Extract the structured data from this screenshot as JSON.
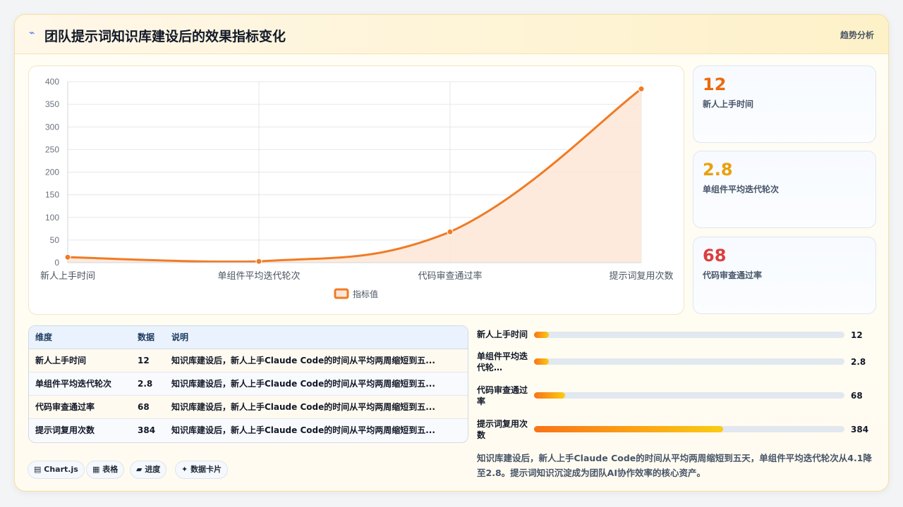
{
  "header": {
    "title": "团队提示词知识库建设后的效果指标变化",
    "tag": "趋势分析",
    "flag_icon": "⌁"
  },
  "chart_data": {
    "type": "area",
    "categories": [
      "新人上手时间",
      "单组件平均迭代轮次",
      "代码审查通过率",
      "提示词复用次数"
    ],
    "series": [
      {
        "name": "指标值",
        "values": [
          12,
          2.8,
          68,
          384
        ]
      }
    ],
    "ylim": [
      0,
      400
    ],
    "yticks": [
      0,
      50,
      100,
      150,
      200,
      250,
      300,
      350,
      400
    ],
    "grid": true,
    "legend": "bottom-center",
    "color": "#f07b25",
    "fill_color": "#fde6d6"
  },
  "kpis": [
    {
      "value": "12",
      "label": "新人上手时间",
      "color": "#ea6a0c"
    },
    {
      "value": "2.8",
      "label": "单组件平均迭代轮次",
      "color": "#e9a10c"
    },
    {
      "value": "68",
      "label": "代码审查通过率",
      "color": "#dc3e3e"
    }
  ],
  "table": {
    "headers": [
      "维度",
      "数据",
      "说明"
    ],
    "rows": [
      [
        "新人上手时间",
        "12",
        "知识库建设后，新人上手Claude Code的时间从平均两周缩短到五..."
      ],
      [
        "单组件平均迭代轮次",
        "2.8",
        "知识库建设后，新人上手Claude Code的时间从平均两周缩短到五..."
      ],
      [
        "代码审查通过率",
        "68",
        "知识库建设后，新人上手Claude Code的时间从平均两周缩短到五..."
      ],
      [
        "提示词复用次数",
        "384",
        "知识库建设后，新人上手Claude Code的时间从平均两周缩短到五..."
      ]
    ]
  },
  "progress": [
    {
      "label": "新人上手时间",
      "value": "12",
      "fraction": 0.047
    },
    {
      "label": "单组件平均迭代轮…",
      "value": "2.8",
      "fraction": 0.047
    },
    {
      "label": "代码审查通过率",
      "value": "68",
      "fraction": 0.1
    },
    {
      "label": "提示词复用次数",
      "value": "384",
      "fraction": 0.61
    }
  ],
  "summary": "知识库建设后，新人上手Claude Code的时间从平均两周缩短到五天，单组件平均迭代轮次从4.1降至2.8。提示词知识沉淀成为团队AI协作效率的核心资产。",
  "chips": [
    {
      "icon": "▤",
      "label": "Chart.js"
    },
    {
      "icon": "▦",
      "label": "表格"
    },
    {
      "icon": "▰",
      "label": "进度"
    },
    {
      "icon": "✦",
      "label": "数据卡片"
    }
  ]
}
